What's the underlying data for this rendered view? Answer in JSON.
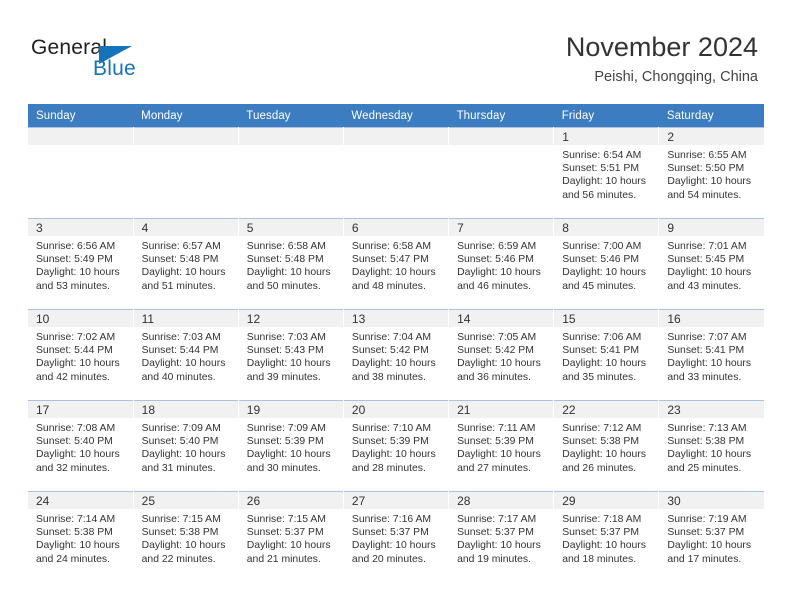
{
  "brand": {
    "name_top": "General",
    "name_bottom": "Blue",
    "accent_color": "#1673bb",
    "triangle_icon": "brand-triangle-icon"
  },
  "header": {
    "title": "November 2024",
    "subtitle": "Peishi, Chongqing, China"
  },
  "theme": {
    "header_row_bg": "#3b7dc0",
    "daynum_band_bg": "#f1f1f1",
    "cell_border": "#a9c2dd",
    "text": "#333333"
  },
  "weekday_headers": [
    "Sunday",
    "Monday",
    "Tuesday",
    "Wednesday",
    "Thursday",
    "Friday",
    "Saturday"
  ],
  "labels": {
    "sunrise_prefix": "Sunrise:",
    "sunset_prefix": "Sunset:",
    "daylight_prefix": "Daylight:"
  },
  "weeks": [
    [
      {
        "day": "",
        "empty": true
      },
      {
        "day": "",
        "empty": true
      },
      {
        "day": "",
        "empty": true
      },
      {
        "day": "",
        "empty": true
      },
      {
        "day": "",
        "empty": true
      },
      {
        "day": "1",
        "sunrise": "Sunrise: 6:54 AM",
        "sunset": "Sunset: 5:51 PM",
        "daylight_l1": "Daylight: 10 hours",
        "daylight_l2": "and 56 minutes."
      },
      {
        "day": "2",
        "sunrise": "Sunrise: 6:55 AM",
        "sunset": "Sunset: 5:50 PM",
        "daylight_l1": "Daylight: 10 hours",
        "daylight_l2": "and 54 minutes."
      }
    ],
    [
      {
        "day": "3",
        "sunrise": "Sunrise: 6:56 AM",
        "sunset": "Sunset: 5:49 PM",
        "daylight_l1": "Daylight: 10 hours",
        "daylight_l2": "and 53 minutes."
      },
      {
        "day": "4",
        "sunrise": "Sunrise: 6:57 AM",
        "sunset": "Sunset: 5:48 PM",
        "daylight_l1": "Daylight: 10 hours",
        "daylight_l2": "and 51 minutes."
      },
      {
        "day": "5",
        "sunrise": "Sunrise: 6:58 AM",
        "sunset": "Sunset: 5:48 PM",
        "daylight_l1": "Daylight: 10 hours",
        "daylight_l2": "and 50 minutes."
      },
      {
        "day": "6",
        "sunrise": "Sunrise: 6:58 AM",
        "sunset": "Sunset: 5:47 PM",
        "daylight_l1": "Daylight: 10 hours",
        "daylight_l2": "and 48 minutes."
      },
      {
        "day": "7",
        "sunrise": "Sunrise: 6:59 AM",
        "sunset": "Sunset: 5:46 PM",
        "daylight_l1": "Daylight: 10 hours",
        "daylight_l2": "and 46 minutes."
      },
      {
        "day": "8",
        "sunrise": "Sunrise: 7:00 AM",
        "sunset": "Sunset: 5:46 PM",
        "daylight_l1": "Daylight: 10 hours",
        "daylight_l2": "and 45 minutes."
      },
      {
        "day": "9",
        "sunrise": "Sunrise: 7:01 AM",
        "sunset": "Sunset: 5:45 PM",
        "daylight_l1": "Daylight: 10 hours",
        "daylight_l2": "and 43 minutes."
      }
    ],
    [
      {
        "day": "10",
        "sunrise": "Sunrise: 7:02 AM",
        "sunset": "Sunset: 5:44 PM",
        "daylight_l1": "Daylight: 10 hours",
        "daylight_l2": "and 42 minutes."
      },
      {
        "day": "11",
        "sunrise": "Sunrise: 7:03 AM",
        "sunset": "Sunset: 5:44 PM",
        "daylight_l1": "Daylight: 10 hours",
        "daylight_l2": "and 40 minutes."
      },
      {
        "day": "12",
        "sunrise": "Sunrise: 7:03 AM",
        "sunset": "Sunset: 5:43 PM",
        "daylight_l1": "Daylight: 10 hours",
        "daylight_l2": "and 39 minutes."
      },
      {
        "day": "13",
        "sunrise": "Sunrise: 7:04 AM",
        "sunset": "Sunset: 5:42 PM",
        "daylight_l1": "Daylight: 10 hours",
        "daylight_l2": "and 38 minutes."
      },
      {
        "day": "14",
        "sunrise": "Sunrise: 7:05 AM",
        "sunset": "Sunset: 5:42 PM",
        "daylight_l1": "Daylight: 10 hours",
        "daylight_l2": "and 36 minutes."
      },
      {
        "day": "15",
        "sunrise": "Sunrise: 7:06 AM",
        "sunset": "Sunset: 5:41 PM",
        "daylight_l1": "Daylight: 10 hours",
        "daylight_l2": "and 35 minutes."
      },
      {
        "day": "16",
        "sunrise": "Sunrise: 7:07 AM",
        "sunset": "Sunset: 5:41 PM",
        "daylight_l1": "Daylight: 10 hours",
        "daylight_l2": "and 33 minutes."
      }
    ],
    [
      {
        "day": "17",
        "sunrise": "Sunrise: 7:08 AM",
        "sunset": "Sunset: 5:40 PM",
        "daylight_l1": "Daylight: 10 hours",
        "daylight_l2": "and 32 minutes."
      },
      {
        "day": "18",
        "sunrise": "Sunrise: 7:09 AM",
        "sunset": "Sunset: 5:40 PM",
        "daylight_l1": "Daylight: 10 hours",
        "daylight_l2": "and 31 minutes."
      },
      {
        "day": "19",
        "sunrise": "Sunrise: 7:09 AM",
        "sunset": "Sunset: 5:39 PM",
        "daylight_l1": "Daylight: 10 hours",
        "daylight_l2": "and 30 minutes."
      },
      {
        "day": "20",
        "sunrise": "Sunrise: 7:10 AM",
        "sunset": "Sunset: 5:39 PM",
        "daylight_l1": "Daylight: 10 hours",
        "daylight_l2": "and 28 minutes."
      },
      {
        "day": "21",
        "sunrise": "Sunrise: 7:11 AM",
        "sunset": "Sunset: 5:39 PM",
        "daylight_l1": "Daylight: 10 hours",
        "daylight_l2": "and 27 minutes."
      },
      {
        "day": "22",
        "sunrise": "Sunrise: 7:12 AM",
        "sunset": "Sunset: 5:38 PM",
        "daylight_l1": "Daylight: 10 hours",
        "daylight_l2": "and 26 minutes."
      },
      {
        "day": "23",
        "sunrise": "Sunrise: 7:13 AM",
        "sunset": "Sunset: 5:38 PM",
        "daylight_l1": "Daylight: 10 hours",
        "daylight_l2": "and 25 minutes."
      }
    ],
    [
      {
        "day": "24",
        "sunrise": "Sunrise: 7:14 AM",
        "sunset": "Sunset: 5:38 PM",
        "daylight_l1": "Daylight: 10 hours",
        "daylight_l2": "and 24 minutes."
      },
      {
        "day": "25",
        "sunrise": "Sunrise: 7:15 AM",
        "sunset": "Sunset: 5:38 PM",
        "daylight_l1": "Daylight: 10 hours",
        "daylight_l2": "and 22 minutes."
      },
      {
        "day": "26",
        "sunrise": "Sunrise: 7:15 AM",
        "sunset": "Sunset: 5:37 PM",
        "daylight_l1": "Daylight: 10 hours",
        "daylight_l2": "and 21 minutes."
      },
      {
        "day": "27",
        "sunrise": "Sunrise: 7:16 AM",
        "sunset": "Sunset: 5:37 PM",
        "daylight_l1": "Daylight: 10 hours",
        "daylight_l2": "and 20 minutes."
      },
      {
        "day": "28",
        "sunrise": "Sunrise: 7:17 AM",
        "sunset": "Sunset: 5:37 PM",
        "daylight_l1": "Daylight: 10 hours",
        "daylight_l2": "and 19 minutes."
      },
      {
        "day": "29",
        "sunrise": "Sunrise: 7:18 AM",
        "sunset": "Sunset: 5:37 PM",
        "daylight_l1": "Daylight: 10 hours",
        "daylight_l2": "and 18 minutes."
      },
      {
        "day": "30",
        "sunrise": "Sunrise: 7:19 AM",
        "sunset": "Sunset: 5:37 PM",
        "daylight_l1": "Daylight: 10 hours",
        "daylight_l2": "and 17 minutes."
      }
    ]
  ]
}
